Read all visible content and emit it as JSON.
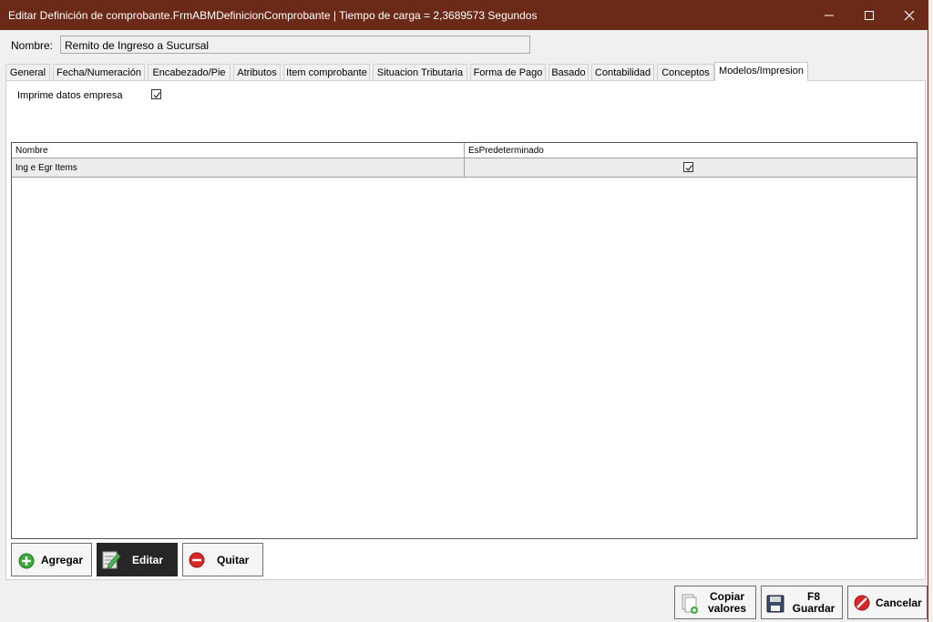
{
  "window": {
    "title": "Editar Definición de comprobante.FrmABMDefinicionComprobante | Tiempo de carga = 2,3689573 Segundos",
    "minimize_glyph": "—",
    "maximize_glyph": "☐",
    "close_glyph": "✕"
  },
  "form": {
    "name_label": "Nombre:",
    "name_value": "Remito de Ingreso a Sucursal"
  },
  "tabs": [
    {
      "label": "General",
      "active": false
    },
    {
      "label": "Fecha/Numeración",
      "active": false
    },
    {
      "label": "Encabezado/Pie",
      "active": false
    },
    {
      "label": "Atributos",
      "active": false
    },
    {
      "label": "Item comprobante",
      "active": false
    },
    {
      "label": "Situacion Tributaria",
      "active": false
    },
    {
      "label": "Forma de Pago",
      "active": false
    },
    {
      "label": "Basado",
      "active": false
    },
    {
      "label": "Contabilidad",
      "active": false
    },
    {
      "label": "Conceptos",
      "active": false
    },
    {
      "label": "Modelos/Impresion",
      "active": true
    }
  ],
  "panel": {
    "imprime_label": "Imprime datos empresa",
    "imprime_checked": true
  },
  "grid": {
    "columns": [
      "Nombre",
      "EsPredeterminado"
    ],
    "rows": [
      {
        "nombre": "Ing e Egr Items",
        "es_predeterminado": true
      }
    ]
  },
  "actions": {
    "agregar": "Agregar",
    "editar": "Editar",
    "quitar": "Quitar"
  },
  "footer": {
    "copiar_line1": "Copiar",
    "copiar_line2": "valores",
    "guardar_line1": "F8",
    "guardar_line2": "Guardar",
    "cancelar": "Cancelar"
  },
  "colors": {
    "titlebar": "#6b2917",
    "add_icon": "#3aa83a",
    "remove_icon": "#d62828",
    "cancel_icon": "#d62828"
  }
}
